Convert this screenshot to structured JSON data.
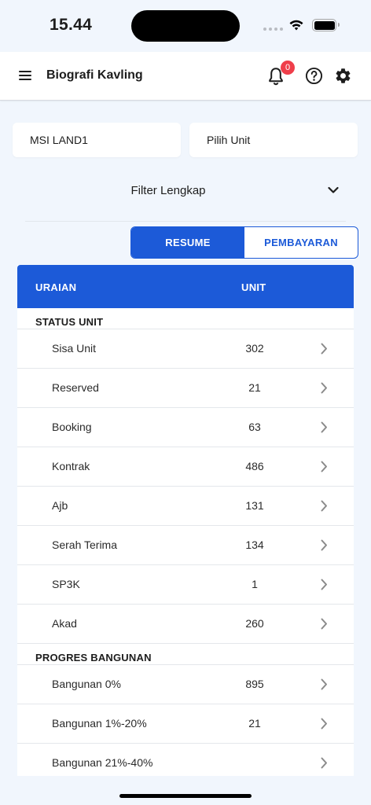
{
  "status_bar": {
    "time": "15.44"
  },
  "app_bar": {
    "title": "Biografi Kavling",
    "notification_count": "0"
  },
  "selectors": {
    "project": "MSI LAND1",
    "unit": "Pilih Unit"
  },
  "filter": {
    "label": "Filter Lengkap"
  },
  "tabs": {
    "resume": "RESUME",
    "pembayaran": "PEMBAYARAN",
    "active": "resume"
  },
  "table": {
    "columns": {
      "uraian": "URAIAN",
      "unit": "UNIT"
    },
    "sections": [
      {
        "title": "STATUS UNIT",
        "rows": [
          {
            "label": "Sisa Unit",
            "value": "302"
          },
          {
            "label": "Reserved",
            "value": "21"
          },
          {
            "label": "Booking",
            "value": "63"
          },
          {
            "label": "Kontrak",
            "value": "486"
          },
          {
            "label": "Ajb",
            "value": "131"
          },
          {
            "label": "Serah Terima",
            "value": "134"
          },
          {
            "label": "SP3K",
            "value": "1"
          },
          {
            "label": "Akad",
            "value": "260"
          }
        ]
      },
      {
        "title": "PROGRES BANGUNAN",
        "rows": [
          {
            "label": "Bangunan 0%",
            "value": "895"
          },
          {
            "label": "Bangunan 1%-20%",
            "value": "21"
          },
          {
            "label": "Bangunan 21%-40%",
            "value": ""
          }
        ]
      }
    ]
  },
  "colors": {
    "primary": "#1c5ad8",
    "background": "#f1f6fd",
    "badge": "#ef3e4a"
  },
  "icons": [
    "menu-icon",
    "bell-icon",
    "help-icon",
    "gear-icon",
    "chevron-down-icon",
    "chevron-right-icon"
  ]
}
